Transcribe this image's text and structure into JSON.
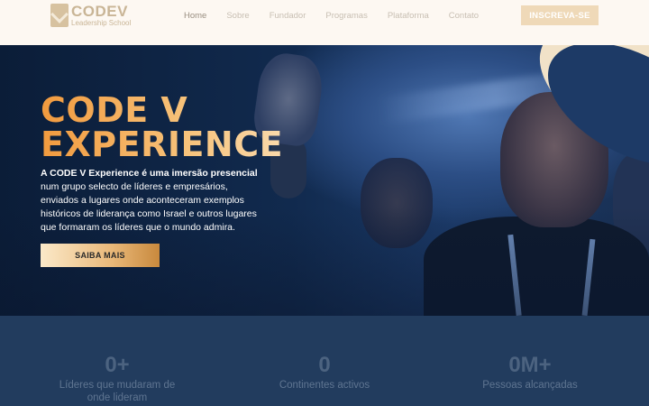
{
  "header": {
    "logo_title": "CODEV",
    "logo_subtitle": "Leadership School",
    "nav": [
      "Home",
      "Sobre",
      "Fundador",
      "Programas",
      "Plataforma",
      "Contato"
    ],
    "cta_label": "INSCREVA-SE"
  },
  "hero": {
    "title_line1": "CODE V",
    "title_line2": "EXPERIENCE",
    "desc_bold": "A CODE V Experience é uma imersão presencial",
    "desc_rest": " num grupo selecto de líderes e empresários, enviados a lugares onde aconteceram exemplos históricos de liderança como Israel e outros lugares que formaram os líderes que o mundo admira.",
    "button_label": "SAIBA MAIS"
  },
  "stats": [
    {
      "number": "0+",
      "label": "Líderes que mudaram de onde lideram"
    },
    {
      "number": "0",
      "label": "Continentes activos"
    },
    {
      "number": "0M+",
      "label": "Pessoas alcançadas"
    }
  ],
  "colors": {
    "header_bg": "#fdf8f2",
    "accent_gold": "#efd9b8",
    "hero_bg": "#112a4e",
    "stats_bg": "#223c5e"
  }
}
